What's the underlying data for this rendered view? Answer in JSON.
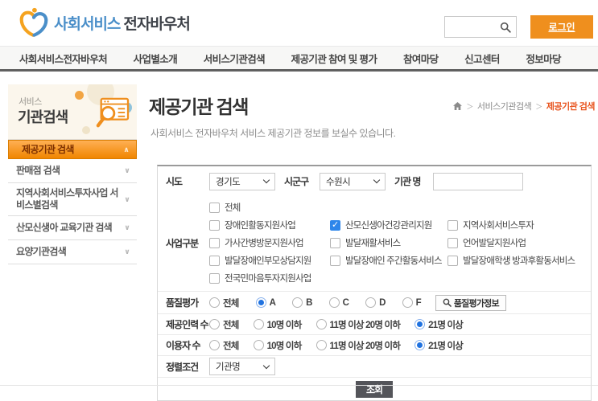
{
  "colors": {
    "accent_orange": "#ef8f1e",
    "logo_blue": "#4b8fc9",
    "checkbox_checked_blue": "#2e86ea",
    "radio_selected_blue": "#1f72e0",
    "breadcrumb_current": "#e8541e",
    "submit_button_dark": "#54555a"
  },
  "header": {
    "logo_text_primary": "사회서비스",
    "logo_text_secondary": "전자바우처",
    "search_value": "",
    "search_placeholder": "",
    "login_label": "로그인"
  },
  "nav": {
    "items": [
      "사회서비스전자바우처",
      "사업별소개",
      "서비스기관검색",
      "제공기관 참여 및 평가",
      "참여마당",
      "신고센터",
      "정보마당"
    ]
  },
  "sidebar": {
    "eyebrow": "서비스",
    "title": "기관검색",
    "items": [
      {
        "label": "제공기관 검색",
        "active": true
      },
      {
        "label": "판매점 검색",
        "active": false
      },
      {
        "label": "지역사회서비스투자사업 서비스별검색",
        "active": false
      },
      {
        "label": "산모신생아 교육기관 검색",
        "active": false
      },
      {
        "label": "요양기관검색",
        "active": false
      }
    ]
  },
  "main": {
    "page_title": "제공기관 검색",
    "page_description": "사회서비스 전자바우처 서비스 제공기관 정보를 보실수 있습니다.",
    "breadcrumb": {
      "items": [
        {
          "label": "서비스기관검색",
          "current": false
        },
        {
          "label": "제공기관 검색",
          "current": true
        }
      ]
    },
    "form": {
      "location": {
        "sido_label": "시도",
        "sido_value": "경기도",
        "sigungu_label": "시군구",
        "sigungu_value": "수원시",
        "org_name_label": "기관 명",
        "org_name_value": ""
      },
      "business": {
        "label": "사업구분",
        "rows": [
          [
            {
              "label": "전체",
              "checked": false
            },
            null,
            null
          ],
          [
            {
              "label": "장애인활동지원사업",
              "checked": false
            },
            {
              "label": "산모신생아건강관리지원",
              "checked": true
            },
            {
              "label": "지역사회서비스투자",
              "checked": false
            }
          ],
          [
            {
              "label": "가사간병방문지원사업",
              "checked": false
            },
            {
              "label": "발달재활서비스",
              "checked": false
            },
            {
              "label": "언어발달지원사업",
              "checked": false
            }
          ],
          [
            {
              "label": "발달장애인부모상담지원",
              "checked": false
            },
            {
              "label": "발달장애인 주간활동서비스",
              "checked": false
            },
            {
              "label": "발달장애학생 방과후활동서비스",
              "checked": false
            }
          ],
          [
            {
              "label": "전국민마음투자지원사업",
              "checked": false
            },
            null,
            null
          ]
        ]
      },
      "quality": {
        "label": "품질평가",
        "options": [
          {
            "label": "전체",
            "selected": false
          },
          {
            "label": "A",
            "selected": true
          },
          {
            "label": "B",
            "selected": false
          },
          {
            "label": "C",
            "selected": false
          },
          {
            "label": "D",
            "selected": false
          },
          {
            "label": "F",
            "selected": false
          }
        ],
        "info_button_label": "품질평가정보"
      },
      "staff_count": {
        "label": "제공인력 수",
        "options": [
          {
            "label": "전체",
            "selected": false
          },
          {
            "label": "10명 이하",
            "selected": false
          },
          {
            "label": "11명 이상 20명 이하",
            "selected": false
          },
          {
            "label": "21명 이상",
            "selected": true
          }
        ]
      },
      "user_count": {
        "label": "이용자 수",
        "options": [
          {
            "label": "전체",
            "selected": false
          },
          {
            "label": "10명 이하",
            "selected": false
          },
          {
            "label": "11명 이상 20명 이하",
            "selected": false
          },
          {
            "label": "21명 이상",
            "selected": true
          }
        ]
      },
      "sort": {
        "label": "정렬조건",
        "value": "기관명"
      },
      "submit_label": "조회"
    }
  }
}
